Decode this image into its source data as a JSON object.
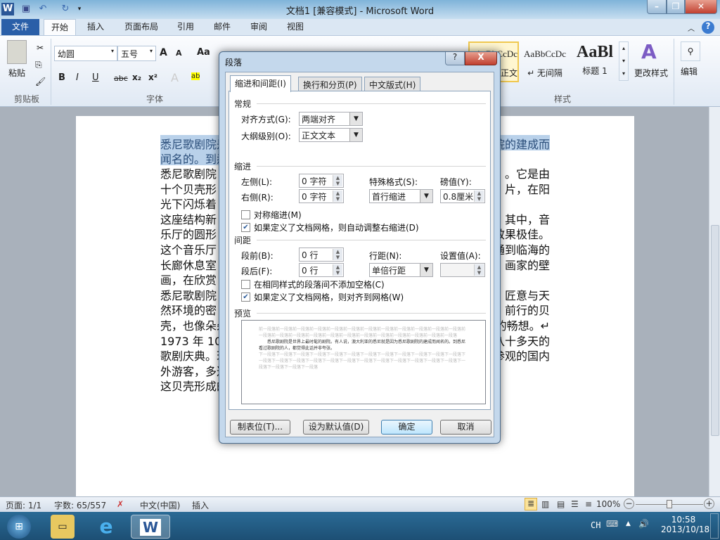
{
  "window": {
    "title": "文档1 [兼容模式] - Microsoft Word",
    "app_icon": "W"
  },
  "ribbon_tabs": [
    "文件",
    "开始",
    "插入",
    "页面布局",
    "引用",
    "邮件",
    "审阅",
    "视图"
  ],
  "ribbon": {
    "clipboard": {
      "paste": "粘贴",
      "group": "剪贴板"
    },
    "font": {
      "name": "幼圆",
      "size": "五号",
      "group": "字体",
      "bold": "B",
      "italic": "I",
      "underline": "U",
      "strike": "abc",
      "sub": "x₂",
      "sup": "x²",
      "grow": "A",
      "shrink": "A",
      "case": "Aa"
    },
    "styles": {
      "items": [
        {
          "preview": "AaBbCcDc",
          "label": "正文"
        },
        {
          "preview": "AaBbCcDc",
          "label": "↵ 无间隔"
        },
        {
          "preview": "AaBl",
          "label": "标题 1"
        }
      ],
      "change": "更改样式",
      "group": "样式"
    },
    "editing": {
      "label": "编辑"
    }
  },
  "document": {
    "lines": [
      {
        "left": "悉尼歌剧院是",
        "right": "院的建成而",
        "selected": true
      },
      {
        "left": "闻名的。到悉",
        "right": "",
        "selected": true
      },
      {
        "left": "悉尼歌剧院",
        "right": "。它是由"
      },
      {
        "left": "十个贝壳形",
        "right": "片，在阳"
      },
      {
        "left": "光下闪烁着",
        "right": ""
      },
      {
        "left": "这座结构新",
        "right": "其中，音"
      },
      {
        "left": "乐厅的圆形",
        "right": "效果极佳。"
      },
      {
        "left": "这个音乐厅",
        "right": "通到临海的"
      },
      {
        "left": "长廊休息室",
        "right": "画家的壁"
      },
      {
        "left": "画，在欣赏",
        "right": ""
      },
      {
        "left": "悉尼歌剧院",
        "right": "匠意与天"
      },
      {
        "left": "然环境的密",
        "right": "前行的贝"
      },
      {
        "left": "壳，也像朵朵",
        "right": "尽的畅想。↵"
      },
      {
        "left": "1973 年 10 月",
        "right": "八十多天的"
      },
      {
        "left": "歌剧庆典。现",
        "right": "参观的国内"
      },
      {
        "left": "外游客，多达",
        "right": ""
      },
      {
        "left": "这贝壳形成的",
        "right": ""
      }
    ]
  },
  "dialog": {
    "title": "段落",
    "help": "?",
    "close": "X",
    "tabs": [
      "缩进和间距(I)",
      "换行和分页(P)",
      "中文版式(H)"
    ],
    "general": {
      "heading": "常规",
      "align_label": "对齐方式(G):",
      "align_value": "两端对齐",
      "outline_label": "大纲级别(O):",
      "outline_value": "正文文本"
    },
    "indent": {
      "heading": "缩进",
      "left_label": "左侧(L):",
      "left_value": "0 字符",
      "right_label": "右侧(R):",
      "right_value": "0 字符",
      "special_label": "特殊格式(S):",
      "special_value": "首行缩进",
      "by_label": "磅值(Y):",
      "by_value": "0.8厘米",
      "mirror": "对称缩进(M)",
      "mirror_checked": false,
      "auto_right": "如果定义了文档网格，则自动调整右缩进(D)",
      "auto_right_checked": true
    },
    "spacing": {
      "heading": "间距",
      "before_label": "段前(B):",
      "before_value": "0 行",
      "after_label": "段后(F):",
      "after_value": "0 行",
      "line_label": "行距(N):",
      "line_value": "单倍行距",
      "at_label": "设置值(A):",
      "at_value": "",
      "no_space": "在相同样式的段落间不添加空格(C)",
      "no_space_checked": false,
      "snap": "如果定义了文档网格，则对齐到网格(W)",
      "snap_checked": true
    },
    "preview": {
      "heading": "预览",
      "prev": "前一段落前一段落前一段落前一段落前一段落前一段落前一段落前一段落前一段落前一段落前一段落前一段落前一段落前一段落前一段落前一段落前一段落前一段落前一段落前一段落前一段落前一段落前一段落前一段落",
      "sample": "悉尼歌剧院是世界上最时髦的剧院。有人说，澳大利亚的悉尼就是因为悉尼歌剧院的建成而闻名的。到悉尼看过歌剧院的人，都觉得此话并非夸张。",
      "next": "下一段落下一段落下一段落下一段落下一段落下一段落下一段落下一段落下一段落下一段落下一段落下一段落下一段落下一段落下一段落下一段落下一段落下一段落下一段落下一段落下一段落下一段落下一段落下一段落下一段落下一段落下一段落下一段落"
    },
    "buttons": {
      "tabs": "制表位(T)...",
      "default": "设为默认值(D)",
      "ok": "确定",
      "cancel": "取消"
    }
  },
  "status": {
    "page": "页面: 1/1",
    "words": "字数: 65/557",
    "lang": "中文(中国)",
    "mode": "插入",
    "zoom": "100%",
    "zoom_level": 100
  },
  "taskbar": {
    "ime": "CH",
    "time": "10:58",
    "date": "2013/10/18"
  }
}
